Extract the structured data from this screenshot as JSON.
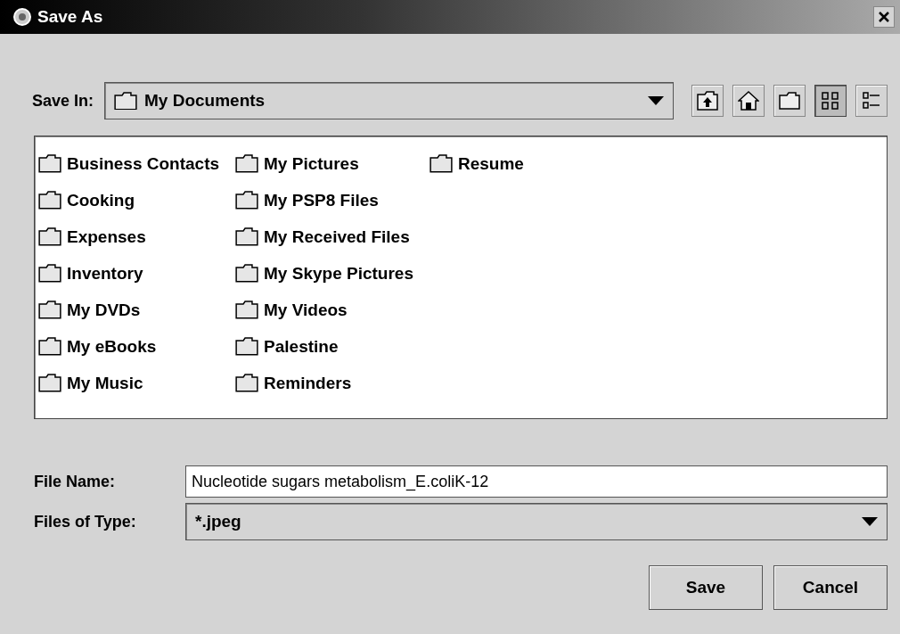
{
  "window": {
    "title": "Save As"
  },
  "save_in": {
    "label": "Save In:",
    "value": "My Documents"
  },
  "toolbar": [
    {
      "kind": "up",
      "selected": false
    },
    {
      "kind": "home",
      "selected": false
    },
    {
      "kind": "new-folder",
      "selected": false
    },
    {
      "kind": "list",
      "selected": true
    },
    {
      "kind": "details",
      "selected": false
    }
  ],
  "files": [
    {
      "name": "Business Contacts"
    },
    {
      "name": "Cooking"
    },
    {
      "name": "Expenses"
    },
    {
      "name": "Inventory"
    },
    {
      "name": "My DVDs"
    },
    {
      "name": "My eBooks"
    },
    {
      "name": "My Music"
    },
    {
      "name": "My Pictures"
    },
    {
      "name": "My PSP8 Files"
    },
    {
      "name": "My Received Files"
    },
    {
      "name": "My Skype Pictures"
    },
    {
      "name": "My Videos"
    },
    {
      "name": "Palestine"
    },
    {
      "name": "Reminders"
    },
    {
      "name": "Resume"
    }
  ],
  "file_name": {
    "label": "File Name:",
    "value": "Nucleotide sugars metabolism_E.coliK-12"
  },
  "file_type": {
    "label": "Files of Type:",
    "value": "*.jpeg"
  },
  "buttons": [
    "Save",
    "Cancel"
  ]
}
